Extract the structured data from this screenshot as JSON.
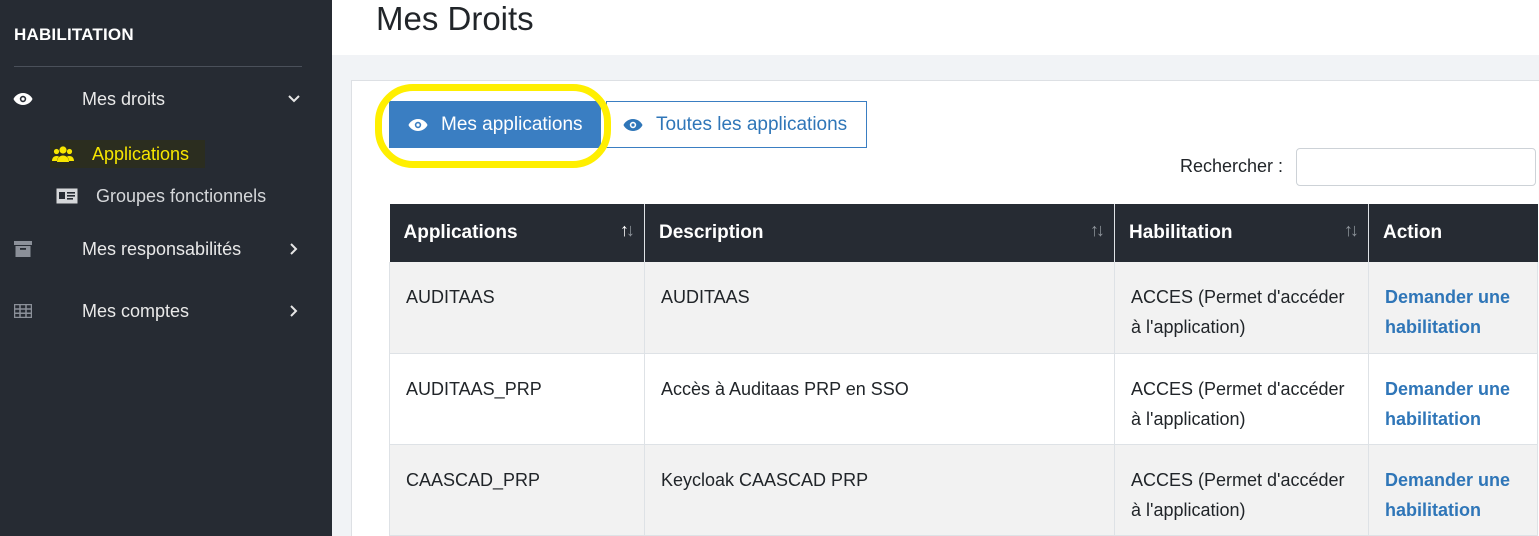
{
  "sidebar": {
    "brand": "HABILITATION",
    "items": [
      {
        "label": "Mes droits",
        "icon": "eye-icon",
        "chevron": "chevron-down-icon",
        "expanded": true
      },
      {
        "label": "Mes responsabilités",
        "icon": "archive-icon",
        "chevron": "chevron-right-icon"
      },
      {
        "label": "Mes comptes",
        "icon": "table-grid-icon",
        "chevron": "chevron-right-icon"
      }
    ],
    "subitems": [
      {
        "label": "Applications",
        "icon": "users-icon",
        "active": true
      },
      {
        "label": "Groupes fonctionnels",
        "icon": "id-card-icon",
        "active": false
      }
    ]
  },
  "page": {
    "title": "Mes Droits"
  },
  "buttons": {
    "mine": "Mes applications",
    "all": "Toutes les applications"
  },
  "search": {
    "label": "Rechercher :",
    "value": ""
  },
  "table": {
    "headers": [
      "Applications",
      "Description",
      "Habilitation",
      "Action"
    ],
    "rows": [
      {
        "app": "AUDITAAS",
        "desc": "AUDITAAS",
        "hab": "ACCES (Permet d'accéder à l'application)",
        "action": "Demander une habilitation"
      },
      {
        "app": "AUDITAAS_PRP",
        "desc": "Accès à Auditaas PRP en SSO",
        "hab": "ACCES (Permet d'accéder à l'application)",
        "action": "Demander une habilitation"
      },
      {
        "app": "CAASCAD_PRP",
        "desc": "Keycloak CAASCAD PRP",
        "hab": "ACCES (Permet d'accéder à l'application)",
        "action": "Demander une habilitation"
      }
    ]
  },
  "colors": {
    "sidebar_bg": "#262b33",
    "primary": "#3a7ec2",
    "active_highlight": "#f7e600",
    "annotation": "#ffef00"
  }
}
